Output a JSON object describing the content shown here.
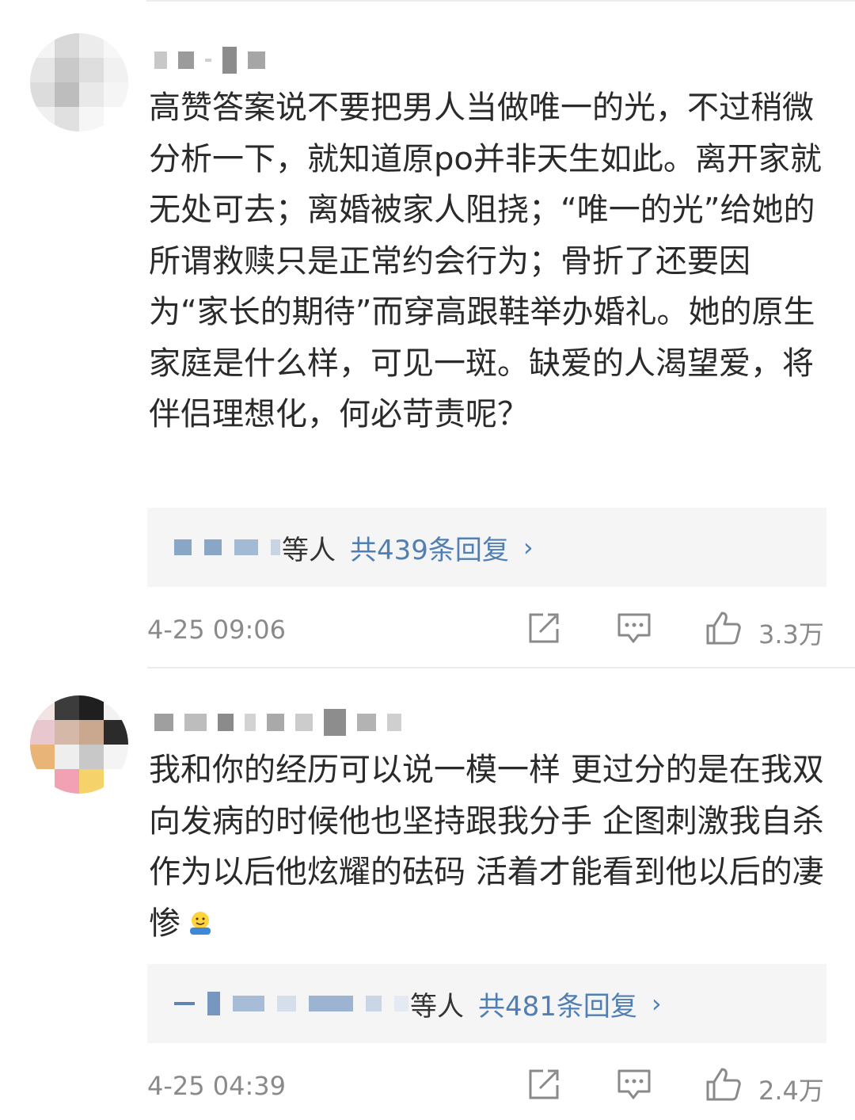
{
  "comments": [
    {
      "text": "高赞答案说不要把男人当做唯一的光，不过稍微分析一下，就知道原po并非天生如此。离开家就无处可去；离婚被家人阻挠；“唯一的光”给她的所谓救赎只是正常约会行为；骨折了还要因为“家长的期待”而穿高跟鞋举办婚礼。她的原生家庭是什么样，可见一斑。缺爱的人渴望爱，将伴侣理想化，何必苛责呢？",
      "replies_suffix": "等人",
      "replies_count": "共439条回复",
      "replies_chevron": "›",
      "timestamp": "4-25 09:06",
      "likes": "3.3万"
    },
    {
      "text": "我和你的经历可以说一模一样 更过分的是在我双向发病的时候他也坚持跟我分手 企图刺激我自杀作为以后他炫耀的砝码 活着才能看到他以后的凄惨",
      "emoji": "hug-emoji",
      "replies_suffix": "等人",
      "replies_count": "共481条回复",
      "replies_chevron": "›",
      "timestamp": "4-25 04:39",
      "likes": "2.4万"
    }
  ],
  "icons": {
    "share": "share-icon",
    "comment": "comment-icon",
    "like": "thumbs-up-icon"
  },
  "colors": {
    "link_blue": "#4f7fb4",
    "meta_gray": "#8a8a8a",
    "reply_bg": "#f5f5f5"
  }
}
